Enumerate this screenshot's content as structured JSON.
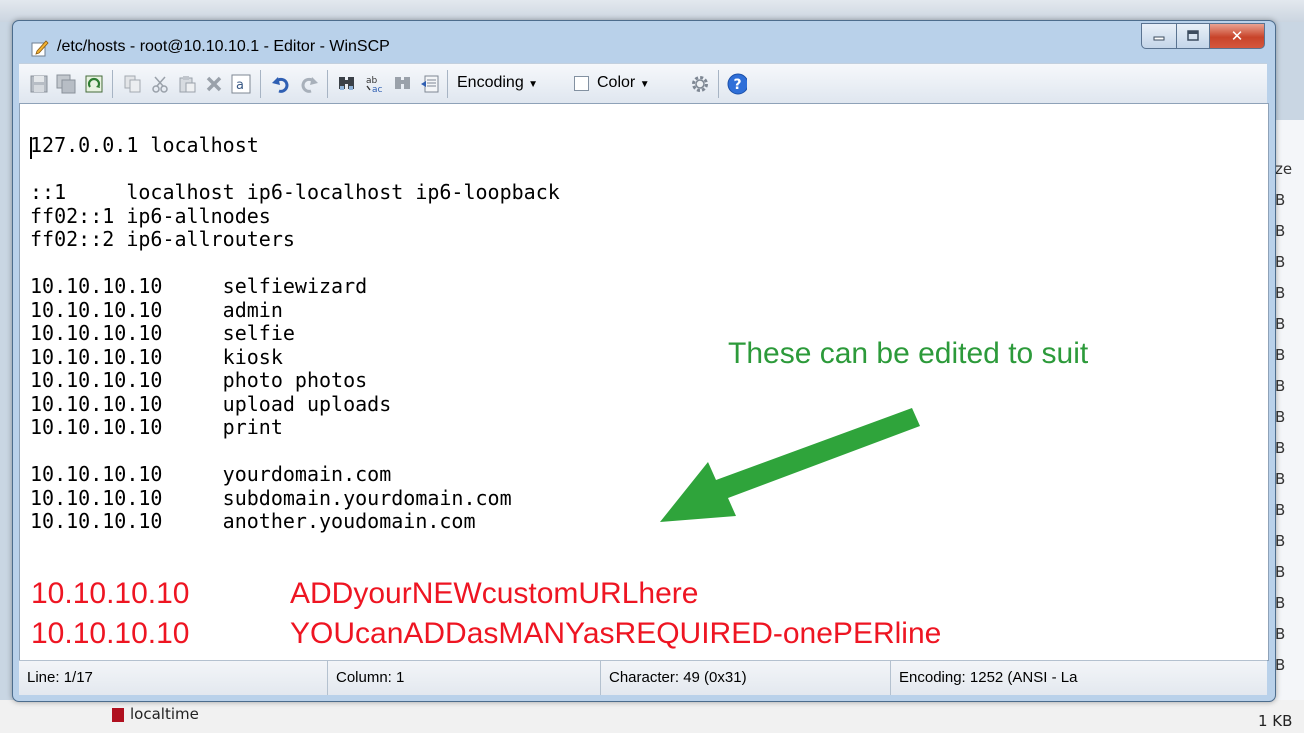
{
  "window": {
    "title": "/etc/hosts - root@10.10.10.1 - Editor - WinSCP"
  },
  "toolbar": {
    "encoding_label": "Encoding",
    "color_label": "Color",
    "icons": [
      "save-icon",
      "save-all-icon",
      "reload-icon",
      "copy-icon",
      "cut-icon",
      "paste-icon",
      "delete-icon",
      "select-all-icon",
      "undo-icon",
      "redo-icon",
      "find-icon",
      "replace-icon",
      "find-next-icon",
      "goto-line-icon",
      "encoding-dropdown-icon",
      "color-dropdown-icon",
      "preferences-gear-icon",
      "help-icon"
    ]
  },
  "editor": {
    "lines": [
      "127.0.0.1 localhost",
      "",
      "::1     localhost ip6-localhost ip6-loopback",
      "ff02::1 ip6-allnodes",
      "ff02::2 ip6-allrouters",
      "",
      "10.10.10.10     selfiewizard",
      "10.10.10.10     admin",
      "10.10.10.10     selfie",
      "10.10.10.10     kiosk",
      "10.10.10.10     photo photos",
      "10.10.10.10     upload uploads",
      "10.10.10.10     print",
      "",
      "10.10.10.10     yourdomain.com",
      "10.10.10.10     subdomain.yourdomain.com",
      "10.10.10.10     another.youdomain.com"
    ],
    "red_lines": [
      {
        "ip": "10.10.10.10",
        "host": "ADDyourNEWcustomURLhere"
      },
      {
        "ip": "10.10.10.10",
        "host": "YOUcanADDasMANYasREQUIRED-onePERline"
      }
    ],
    "annotation": "These can be edited to suit",
    "colors": {
      "red_text": "#ee1522",
      "annotation_green": "#2c9a3a"
    }
  },
  "status": {
    "line": "Line: 1/17",
    "column": "Column: 1",
    "character": "Character: 49 (0x31)",
    "encoding": "Encoding: 1252  (ANSI - La"
  },
  "background": {
    "right_labels": [
      "ze",
      "B",
      "B",
      "B",
      "B",
      "B",
      "B",
      "B",
      "B",
      "B",
      "B",
      "B",
      "B",
      "B",
      "B",
      "B",
      "B"
    ],
    "bottom_file": "localtime",
    "bottom_size": "1 KB"
  }
}
